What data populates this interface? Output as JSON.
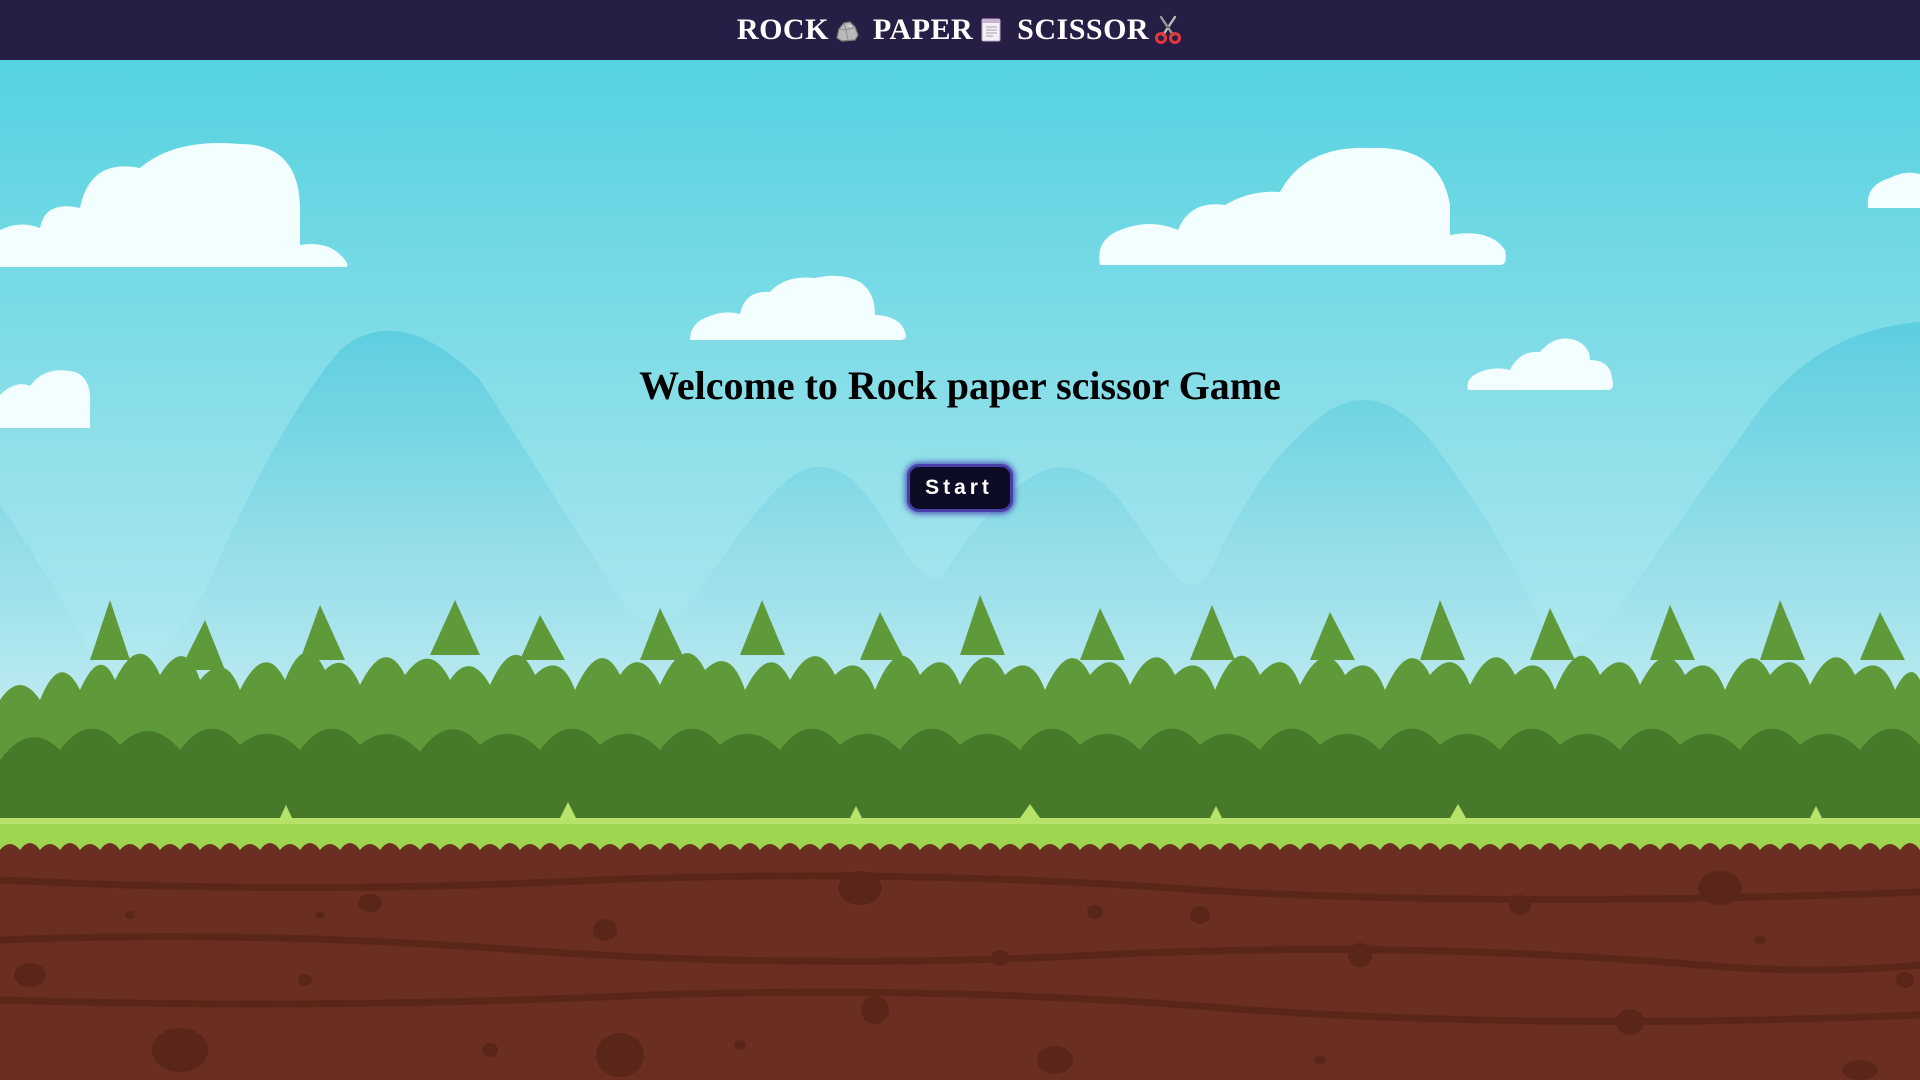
{
  "header": {
    "background": "#261e45",
    "title_parts": [
      {
        "label": "ROCK",
        "icon": "rock-icon"
      },
      {
        "label": "PAPER",
        "icon": "paper-icon"
      },
      {
        "label": "SCISSOR",
        "icon": "scissors-icon"
      }
    ]
  },
  "main": {
    "welcome_text": "Welcome to Rock paper scissor Game",
    "start_label": "Start"
  },
  "colors": {
    "sky_top": "#55d2e0",
    "sky_bottom": "#e8f8fa",
    "hills": "#5ecfdf",
    "bushes_dark": "#467a2a",
    "bushes_light": "#5f9a3a",
    "grass": "#9ed44f",
    "soil": "#6a2f20",
    "button_bg": "#0c0c24",
    "button_border": "#4a3fa8"
  }
}
